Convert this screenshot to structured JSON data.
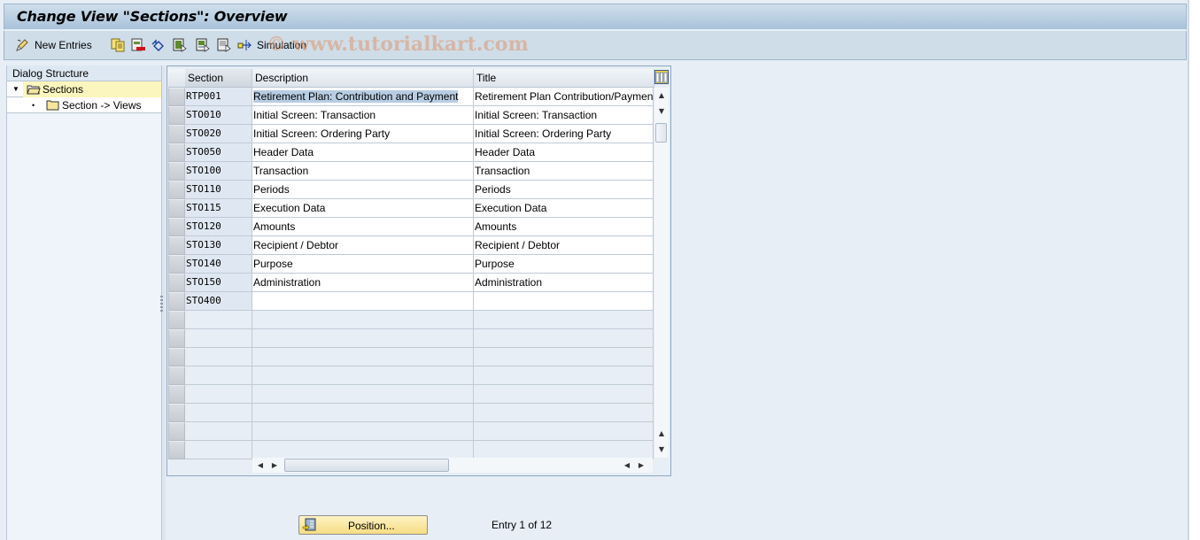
{
  "window": {
    "title": "Change View \"Sections\": Overview"
  },
  "toolbar": {
    "items": [
      {
        "icon": "edit-pencil-icon",
        "label": "New Entries"
      },
      {
        "icon": "copy-icon",
        "label": ""
      },
      {
        "icon": "delete-icon",
        "label": ""
      },
      {
        "icon": "undo-change-icon",
        "label": ""
      },
      {
        "icon": "select-all-icon",
        "label": ""
      },
      {
        "icon": "select-block-icon",
        "label": ""
      },
      {
        "icon": "deselect-all-icon",
        "label": ""
      },
      {
        "icon": "simulation-icon",
        "label": "Simulation"
      }
    ],
    "watermark": "© www.tutorialkart.com"
  },
  "dialog_structure": {
    "header": "Dialog Structure",
    "nodes": [
      {
        "label": "Sections",
        "level": 0,
        "expanded": true,
        "selected": true,
        "icon": "folder-open-icon"
      },
      {
        "label": "Section -> Views",
        "level": 1,
        "selected": false,
        "icon": "folder-icon"
      }
    ]
  },
  "table": {
    "columns": [
      "Section",
      "Description",
      "Title"
    ],
    "rows": [
      {
        "section": "RTP001",
        "description": "Retirement Plan: Contribution and Payment",
        "title": "Retirement Plan Contribution/Payment"
      },
      {
        "section": "STO010",
        "description": "Initial Screen: Transaction",
        "title": "Initial Screen: Transaction"
      },
      {
        "section": "STO020",
        "description": "Initial Screen: Ordering Party",
        "title": "Initial Screen: Ordering Party"
      },
      {
        "section": "STO050",
        "description": "Header Data",
        "title": "Header Data"
      },
      {
        "section": "STO100",
        "description": "Transaction",
        "title": "Transaction"
      },
      {
        "section": "STO110",
        "description": "Periods",
        "title": "Periods"
      },
      {
        "section": "STO115",
        "description": "Execution Data",
        "title": "Execution Data"
      },
      {
        "section": "STO120",
        "description": "Amounts",
        "title": "Amounts"
      },
      {
        "section": "STO130",
        "description": "Recipient / Debtor",
        "title": "Recipient / Debtor"
      },
      {
        "section": "STO140",
        "description": "Purpose",
        "title": "Purpose"
      },
      {
        "section": "STO150",
        "description": "Administration",
        "title": "Administration"
      },
      {
        "section": "STO400",
        "description": "",
        "title": ""
      }
    ],
    "empty_rows": 8
  },
  "footer": {
    "position_button": "Position...",
    "entry_info": "Entry 1 of 12"
  }
}
